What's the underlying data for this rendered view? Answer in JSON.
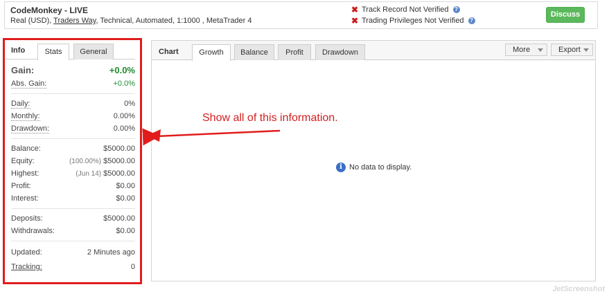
{
  "header": {
    "account_name": "CodeMonkey - LIVE",
    "account_type": "Real (USD),",
    "broker": "Traders Way",
    "details": ", Technical, Automated, 1:1000 , MetaTrader 4",
    "verification": [
      {
        "label": "Track Record Not Verified"
      },
      {
        "label": "Trading Privileges Not Verified"
      }
    ],
    "discuss_label": "Discuss"
  },
  "info_panel": {
    "title": "Info",
    "tabs": [
      "Stats",
      "General"
    ],
    "gain_label": "Gain:",
    "gain_value": "+0.0%",
    "abs_gain_label": "Abs. Gain:",
    "abs_gain_value": "+0.0%",
    "daily_label": "Daily:",
    "daily_value": "0%",
    "monthly_label": "Monthly:",
    "monthly_value": "0.00%",
    "drawdown_label": "Drawdown:",
    "drawdown_value": "0.00%",
    "balance_label": "Balance:",
    "balance_value": "$5000.00",
    "equity_label": "Equity:",
    "equity_note": "(100.00%)",
    "equity_value": "$5000.00",
    "highest_label": "Highest:",
    "highest_note": "(Jun 14)",
    "highest_value": "$5000.00",
    "profit_label": "Profit:",
    "profit_value": "$0.00",
    "interest_label": "Interest:",
    "interest_value": "$0.00",
    "deposits_label": "Deposits:",
    "deposits_value": "$5000.00",
    "withdrawals_label": "Withdrawals:",
    "withdrawals_value": "$0.00",
    "updated_label": "Updated:",
    "updated_value": "2 Minutes ago",
    "tracking_label": "Tracking:",
    "tracking_value": "0"
  },
  "chart_panel": {
    "title": "Chart",
    "tabs": [
      "Growth",
      "Balance",
      "Profit",
      "Drawdown"
    ],
    "more_label": "More",
    "export_label": "Export",
    "no_data": "No data to display."
  },
  "annotation": {
    "text": "Show all of this information.",
    "color": "#d42020"
  },
  "watermark": "JetScreenshot"
}
